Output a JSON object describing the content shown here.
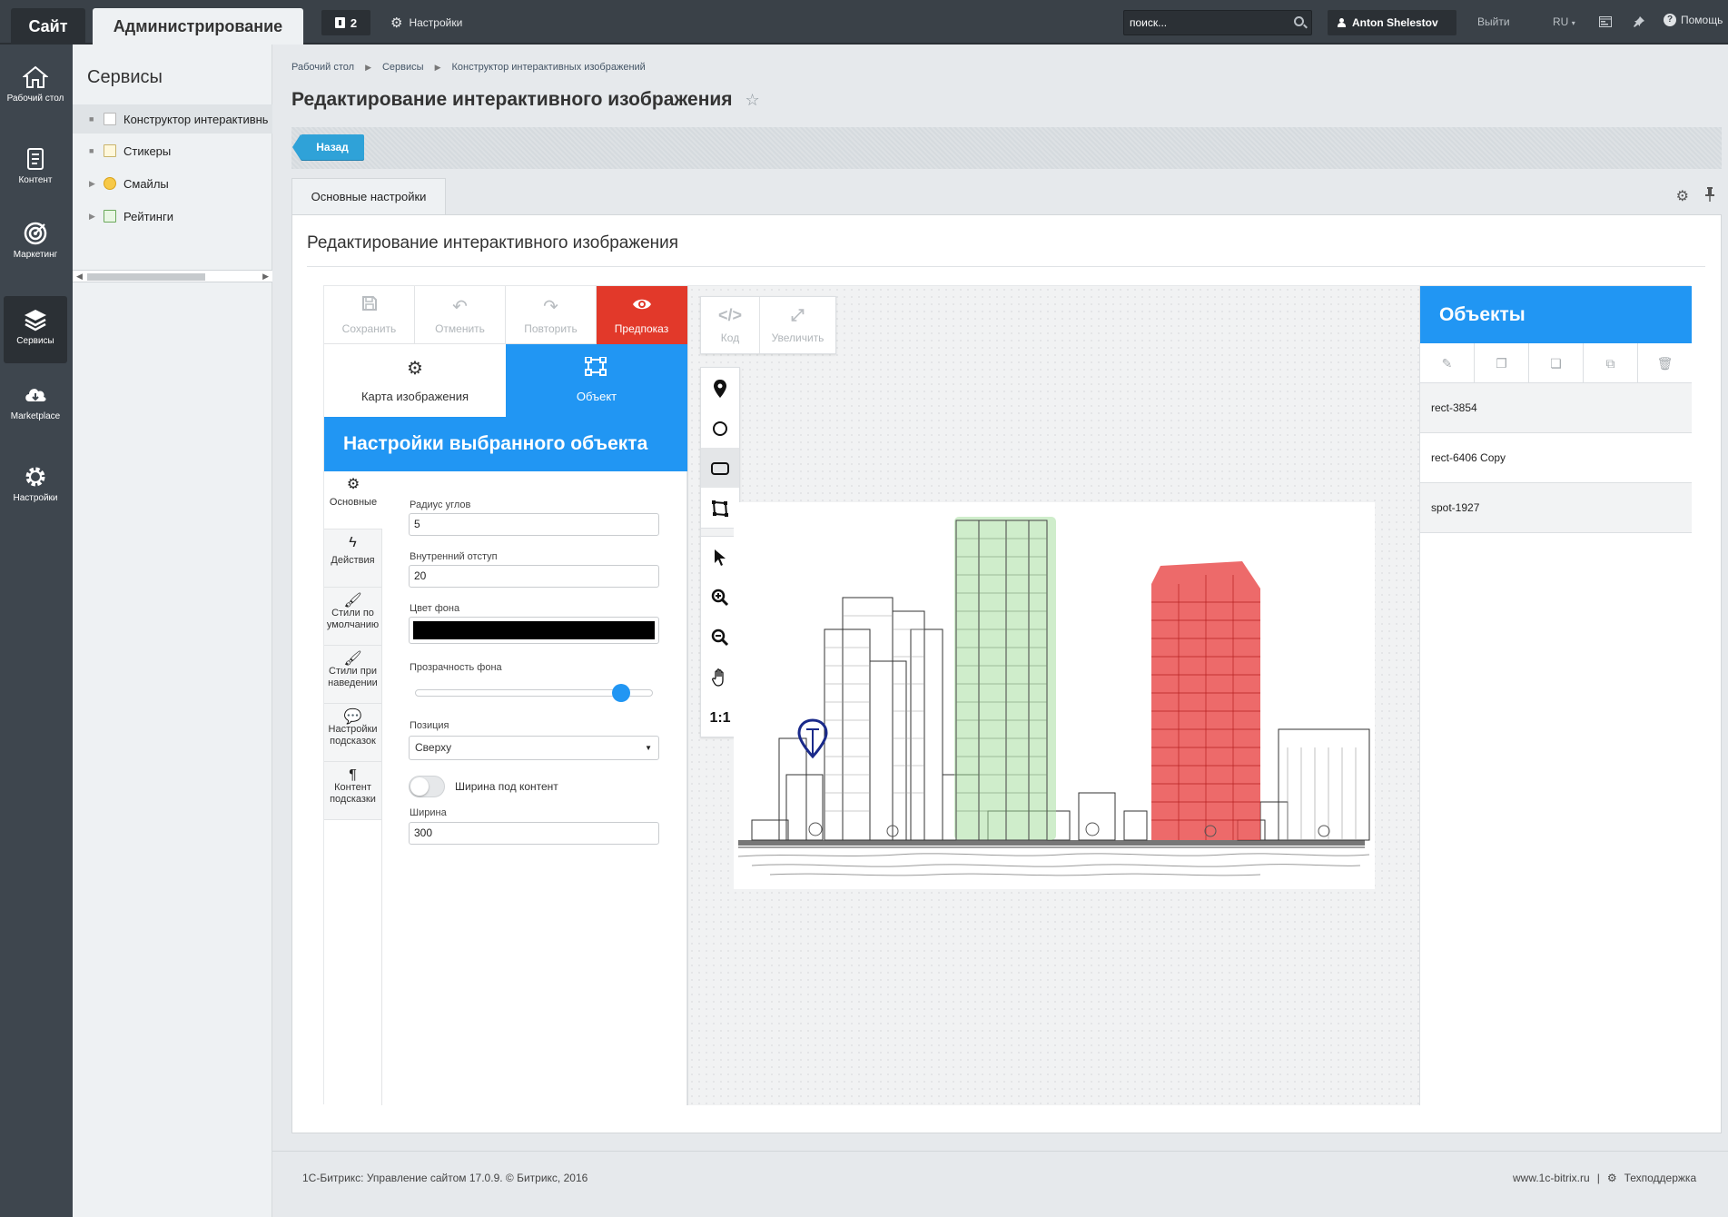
{
  "topbar": {
    "site_tab": "Сайт",
    "admin_tab": "Администрирование",
    "notifications_count": "2",
    "settings_label": "Настройки",
    "search_placeholder": "поиск...",
    "user_name": "Anton Shelestov",
    "logout_label": "Выйти",
    "lang_label": "RU",
    "help_label": "Помощь"
  },
  "leftmenu": [
    {
      "label": "Рабочий стол",
      "icon": "home-icon"
    },
    {
      "label": "Контент",
      "icon": "document-icon"
    },
    {
      "label": "Маркетинг",
      "icon": "target-icon"
    },
    {
      "label": "Сервисы",
      "icon": "layers-icon"
    },
    {
      "label": "Marketplace",
      "icon": "cloud-download-icon"
    },
    {
      "label": "Настройки",
      "icon": "gear-icon"
    }
  ],
  "services": {
    "title": "Сервисы",
    "items": [
      {
        "label": "Конструктор интерактивных изображений"
      },
      {
        "label": "Стикеры"
      },
      {
        "label": "Смайлы"
      },
      {
        "label": "Рейтинги"
      }
    ]
  },
  "breadcrumb": [
    "Рабочий стол",
    "Сервисы",
    "Конструктор интерактивных изображений"
  ],
  "page": {
    "title": "Редактирование интерактивного изображения",
    "back_button": "Назад",
    "tab_main": "Основные настройки",
    "content_title": "Редактирование интерактивного изображения"
  },
  "editor": {
    "toolbar": {
      "save": "Сохранить",
      "undo": "Отменить",
      "redo": "Повторить",
      "preview": "Предпоказ"
    },
    "modes": {
      "image_map": "Карта изображения",
      "object": "Объект"
    },
    "settings_title": "Настройки выбранного объекта",
    "side_tabs": {
      "basic": "Основные",
      "actions": "Действия",
      "default_styles_1": "Стили по",
      "default_styles_2": "умолчанию",
      "hover_styles_1": "Стили при",
      "hover_styles_2": "наведении",
      "tooltip_settings_1": "Настройки",
      "tooltip_settings_2": "подсказок",
      "tooltip_content_1": "Контент",
      "tooltip_content_2": "подсказки"
    },
    "form": {
      "corner_radius_label": "Радиус углов",
      "corner_radius_value": "5",
      "padding_label": "Внутренний отступ",
      "padding_value": "20",
      "bg_color_label": "Цвет фона",
      "bg_color_value": "#000000",
      "bg_opacity_label": "Прозрачность фона",
      "bg_opacity_value": 0.9,
      "position_label": "Позиция",
      "position_value": "Сверху",
      "fit_content_label": "Ширина под контент",
      "width_label": "Ширина",
      "width_value": "300"
    },
    "canvas": {
      "code_label": "Код",
      "zoom_label": "Увеличить",
      "reset_zoom_label": "1:1"
    },
    "objects": {
      "title": "Объекты",
      "items": [
        "rect-3854",
        "rect-6406 Copy",
        "spot-1927"
      ]
    }
  },
  "colors": {
    "accent_blue": "#2196f3",
    "preview_red": "#e2392a",
    "topbar": "#3a4148"
  },
  "footer": {
    "copyright": "1С-Битрикс: Управление сайтом 17.0.9. © Битрикс, 2016",
    "site_link": "www.1c-bitrix.ru",
    "separator": "|",
    "support": "Техподдержка"
  }
}
